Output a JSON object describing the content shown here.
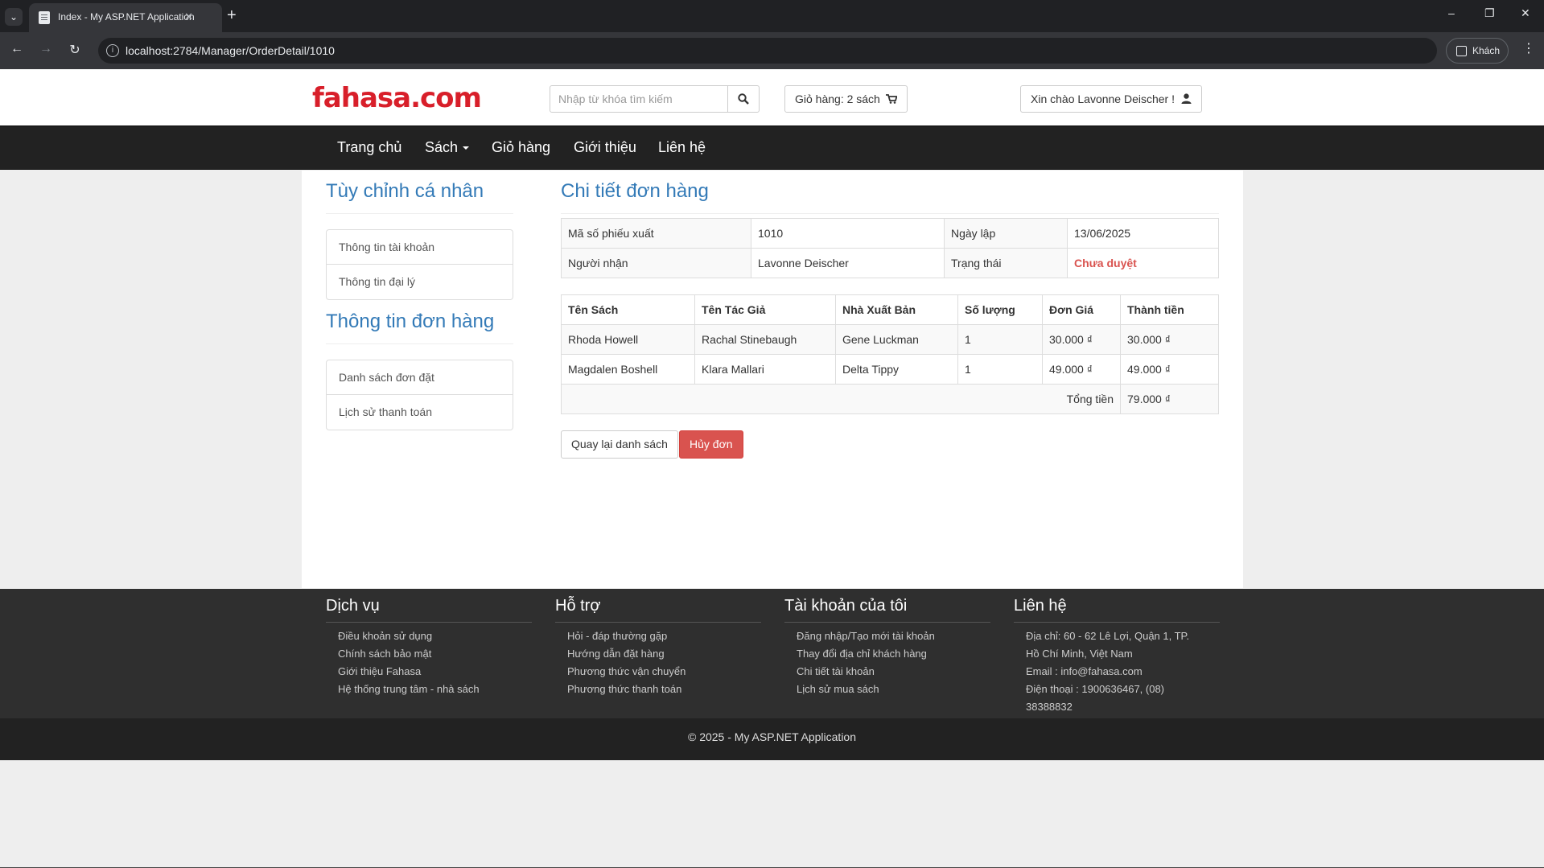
{
  "browser": {
    "tab_title": "Index - My ASP.NET Application",
    "url": "localhost:2784/Manager/OrderDetail/1010",
    "profile_label": "Khách"
  },
  "header": {
    "logo_text": "fahasa.com",
    "search_placeholder": "Nhập từ khóa tìm kiếm",
    "cart_label": "Giỏ hàng: 2 sách",
    "user_greeting": "Xin chào Lavonne Deischer !"
  },
  "nav": {
    "items": [
      "Trang chủ",
      "Sách",
      "Giỏ hàng",
      "Giới thiệu",
      "Liên hệ"
    ]
  },
  "sidebar": {
    "personal_title": "Tùy chỉnh cá nhân",
    "personal_items": [
      "Thông tin tài khoản",
      "Thông tin đại lý"
    ],
    "orders_title": "Thông tin đơn hàng",
    "orders_items": [
      "Danh sách đơn đặt",
      "Lịch sử thanh toán"
    ]
  },
  "order": {
    "title": "Chi tiết đơn hàng",
    "labels": {
      "id": "Mã số phiếu xuất",
      "date": "Ngày lập",
      "recipient": "Người nhận",
      "status": "Trạng thái"
    },
    "id": "1010",
    "date": "13/06/2025",
    "recipient": "Lavonne Deischer",
    "status": "Chưa duyệt",
    "status_color": "#d9534f",
    "columns": [
      "Tên Sách",
      "Tên Tác Giả",
      "Nhà Xuất Bản",
      "Số lượng",
      "Đơn Giá",
      "Thành tiền"
    ],
    "rows": [
      [
        "Rhoda Howell",
        "Rachal Stinebaugh",
        "Gene Luckman",
        "1",
        "30.000 ₫",
        "30.000 ₫"
      ],
      [
        "Magdalen Boshell",
        "Klara Mallari",
        "Delta Tippy",
        "1",
        "49.000 ₫",
        "49.000 ₫"
      ]
    ],
    "total_label": "Tổng tiền",
    "total_value": "79.000 ₫",
    "back_button": "Quay lại danh sách",
    "cancel_button": "Hủy đơn"
  },
  "footer": {
    "columns": [
      {
        "title": "Dịch vụ",
        "links": [
          "Điều khoản sử dụng",
          "Chính sách bảo mật",
          "Giới thiệu Fahasa",
          "Hệ thống trung tâm - nhà sách"
        ]
      },
      {
        "title": "Hỗ trợ",
        "links": [
          "Hỏi - đáp thường gặp",
          "Hướng dẫn đặt hàng",
          "Phương thức vận chuyển",
          "Phương thức thanh toán"
        ]
      },
      {
        "title": "Tài khoản của tôi",
        "links": [
          "Đăng nhập/Tạo mới tài khoản",
          "Thay đổi địa chỉ khách hàng",
          "Chi tiết tài khoản",
          "Lịch sử mua sách"
        ]
      },
      {
        "title": "Liên hệ",
        "links": [
          "Địa chỉ: 60 - 62 Lê Lợi, Quận 1, TP.",
          "Hồ Chí Minh, Việt Nam",
          "Email : info@fahasa.com",
          "Điện thoại : 1900636467, (08)",
          "38388832"
        ]
      }
    ],
    "copyright": "© 2025 - My ASP.NET Application"
  },
  "colors": {
    "brand_red": "#d81f2a",
    "link_blue": "#337ab7",
    "navbar": "#222222",
    "danger": "#d9534f"
  }
}
